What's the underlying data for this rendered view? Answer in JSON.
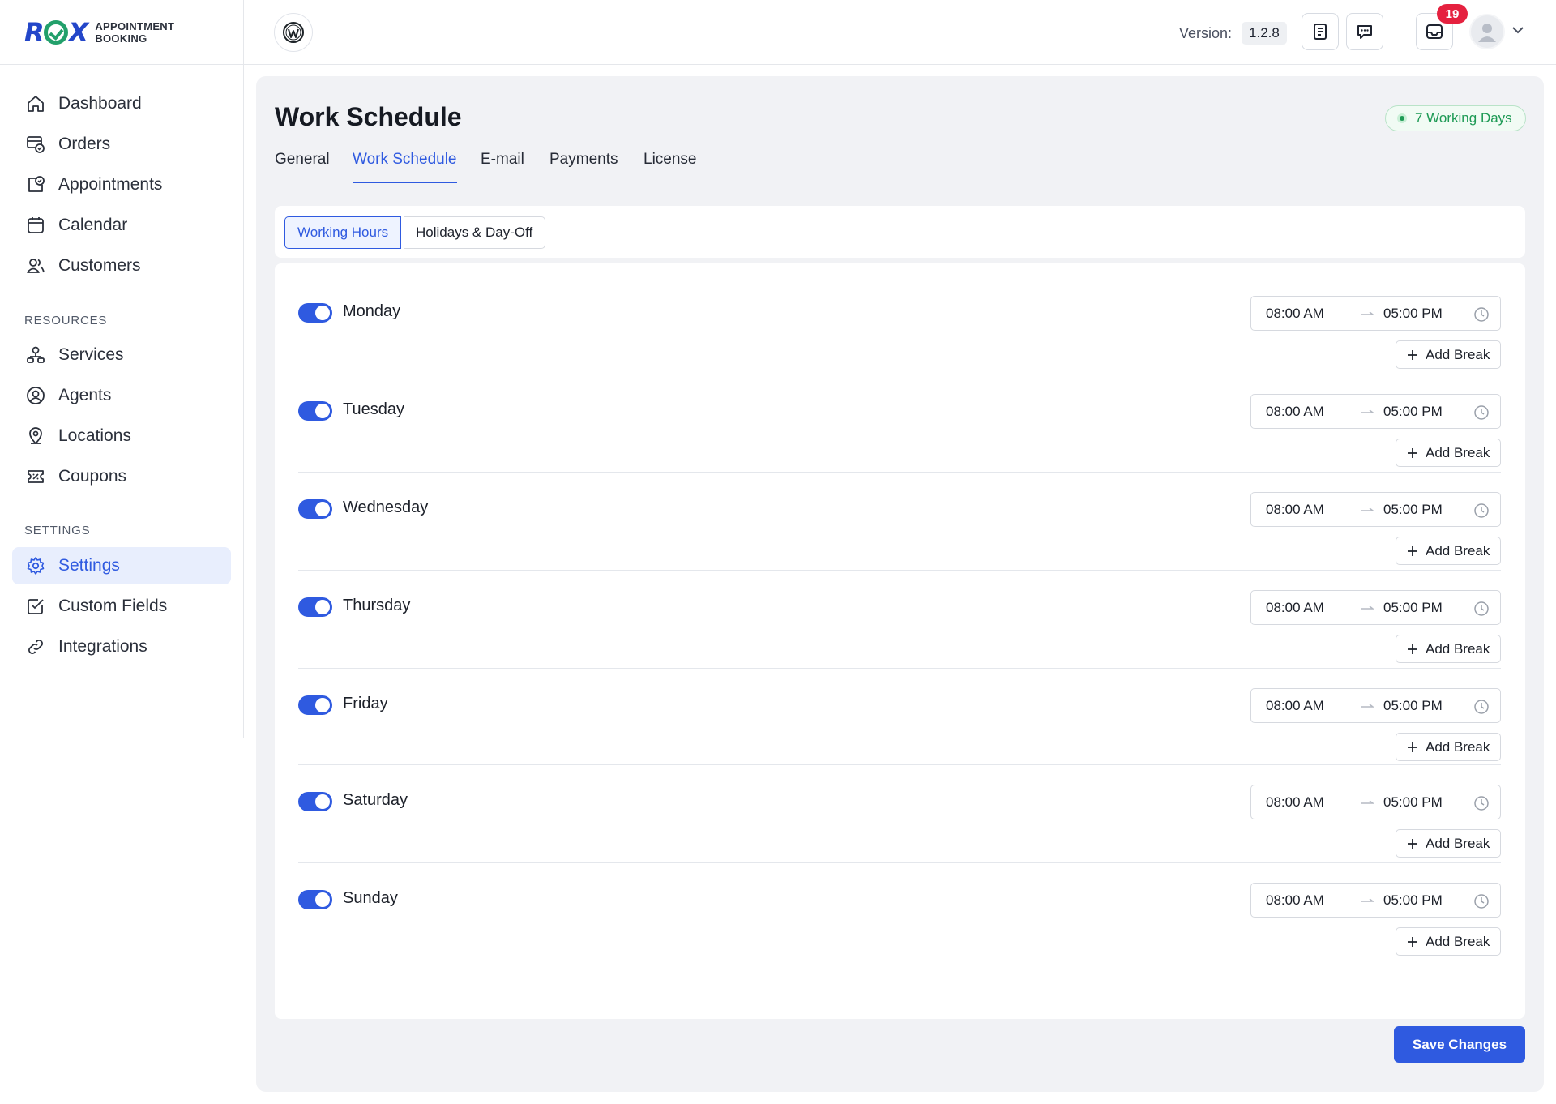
{
  "brand": {
    "name_line1": "APPOINTMENT",
    "name_line2": "BOOKING",
    "mark_left": "R",
    "mark_right": "X"
  },
  "header": {
    "version_label": "Version:",
    "version_value": "1.2.8",
    "notification_count": "19",
    "icons": [
      "wordpress-icon",
      "docs-icon",
      "chat-icon",
      "inbox-icon",
      "user-avatar",
      "chevron-down-icon"
    ]
  },
  "sidebar": {
    "items": [
      {
        "label": "Dashboard",
        "icon": "home-icon"
      },
      {
        "label": "Orders",
        "icon": "orders-icon"
      },
      {
        "label": "Appointments",
        "icon": "appointments-icon"
      },
      {
        "label": "Calendar",
        "icon": "calendar-icon"
      },
      {
        "label": "Customers",
        "icon": "customers-icon"
      }
    ],
    "resources_title": "RESOURCES",
    "resources": [
      {
        "label": "Services",
        "icon": "services-icon"
      },
      {
        "label": "Agents",
        "icon": "agent-icon"
      },
      {
        "label": "Locations",
        "icon": "location-pin-icon"
      },
      {
        "label": "Coupons",
        "icon": "coupon-icon"
      }
    ],
    "settings_title": "SETTINGS",
    "settings": [
      {
        "label": "Settings",
        "icon": "gear-icon",
        "active": true
      },
      {
        "label": "Custom Fields",
        "icon": "checkbox-icon"
      },
      {
        "label": "Integrations",
        "icon": "link-icon"
      }
    ]
  },
  "page": {
    "title": "Work Schedule",
    "working_days_badge": "7 Working Days",
    "tabs": [
      "General",
      "Work Schedule",
      "E-mail",
      "Payments",
      "License"
    ],
    "active_tab": "Work Schedule",
    "subtabs": [
      "Working Hours",
      "Holidays & Day-Off"
    ],
    "active_subtab": "Working Hours",
    "add_break_label": "Add Break",
    "save_label": "Save Changes"
  },
  "days": [
    {
      "name": "Monday",
      "enabled": true,
      "start": "08:00 AM",
      "end": "05:00 PM"
    },
    {
      "name": "Tuesday",
      "enabled": true,
      "start": "08:00 AM",
      "end": "05:00 PM"
    },
    {
      "name": "Wednesday",
      "enabled": true,
      "start": "08:00 AM",
      "end": "05:00 PM"
    },
    {
      "name": "Thursday",
      "enabled": true,
      "start": "08:00 AM",
      "end": "05:00 PM"
    },
    {
      "name": "Friday",
      "enabled": true,
      "start": "08:00 AM",
      "end": "05:00 PM"
    },
    {
      "name": "Saturday",
      "enabled": true,
      "start": "08:00 AM",
      "end": "05:00 PM"
    },
    {
      "name": "Sunday",
      "enabled": true,
      "start": "08:00 AM",
      "end": "05:00 PM"
    }
  ],
  "colors": {
    "accent": "#2f5ae0",
    "success": "#1e9a55",
    "danger": "#e5213f",
    "panel_bg": "#f1f2f5"
  }
}
